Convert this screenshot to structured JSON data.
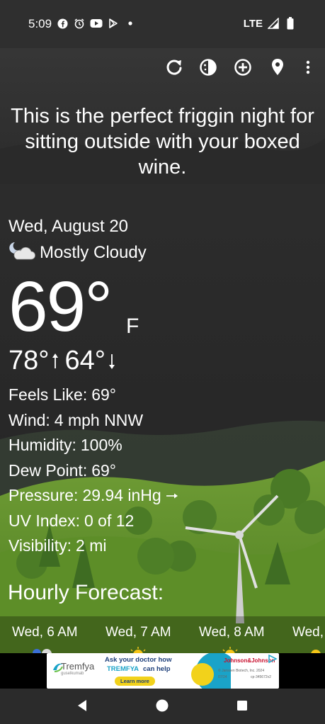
{
  "status_bar": {
    "time": "5:09",
    "left_icons": [
      "facebook-icon",
      "alarm-icon",
      "youtube-icon",
      "play-store-icon",
      "dot-icon"
    ],
    "network": "LTE",
    "right_icons": [
      "signal-icon",
      "battery-icon"
    ]
  },
  "toolbar": {
    "buttons": [
      "refresh-icon",
      "theme-icon",
      "add-location-icon",
      "location-pin-icon",
      "more-icon"
    ]
  },
  "phrase": "This is the perfect friggin night for sitting outside with your boxed wine.",
  "weather": {
    "date": "Wed, August 20",
    "condition": "Mostly Cloudy",
    "condition_icon": "partly-cloudy-night-icon",
    "temperature": "69°",
    "unit": "F",
    "high": "78°",
    "low": "64°"
  },
  "details": [
    {
      "label": "Feels Like:",
      "value": "69°"
    },
    {
      "label": "Wind:",
      "value": "4 mph NNW"
    },
    {
      "label": "Humidity:",
      "value": "100%"
    },
    {
      "label": "Dew Point:",
      "value": "69°"
    },
    {
      "label": "Pressure:",
      "value": "29.94 inHg"
    },
    {
      "label": "UV Index:",
      "value": "0 of 12"
    },
    {
      "label": "Visibility:",
      "value": "2 mi"
    }
  ],
  "hourly": {
    "title": "Hourly Forecast:",
    "items": [
      "Wed, 6 AM",
      "Wed, 7 AM",
      "Wed, 8 AM",
      "Wed,"
    ]
  },
  "ad": {
    "brand": "Tremfya",
    "line1": "Ask your doctor how",
    "line2": "TREMFYA",
    "line3": "can help",
    "cta": "Learn more",
    "sponsor": "Johnson&Johnson",
    "fine_print_1": "© Janssen Biotech, Inc. 2024",
    "fine_print_2": "07/24",
    "fine_print_3": "cp-345672v2",
    "brand_sub": "guselkumab"
  },
  "colors": {
    "sky": "#262626",
    "grass": "#5a8a2a",
    "trees": "#4a7a2c"
  }
}
